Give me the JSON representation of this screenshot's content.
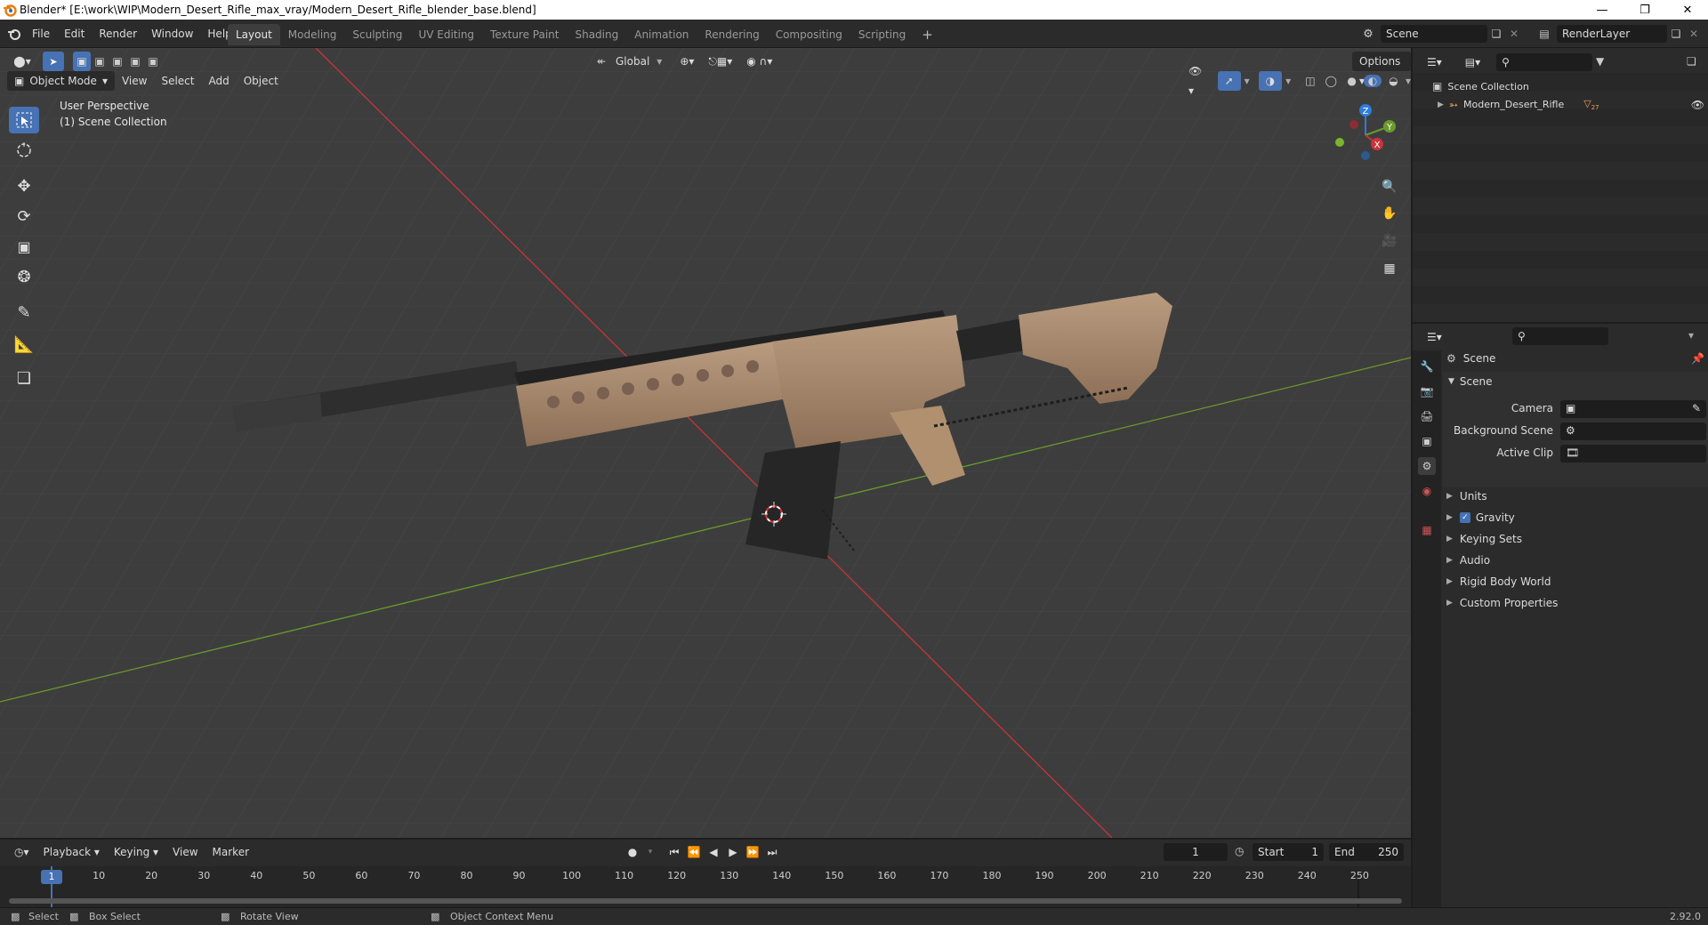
{
  "app": {
    "title": "Blender* [E:\\work\\WIP\\Modern_Desert_Rifle_max_vray/Modern_Desert_Rifle_blender_base.blend]",
    "version": "2.92.0"
  },
  "menu": [
    "File",
    "Edit",
    "Render",
    "Window",
    "Help"
  ],
  "workspaces": [
    "Layout",
    "Modeling",
    "Sculpting",
    "UV Editing",
    "Texture Paint",
    "Shading",
    "Animation",
    "Rendering",
    "Compositing",
    "Scripting"
  ],
  "active_workspace": "Layout",
  "scene_field": "Scene",
  "render_layer": "RenderLayer",
  "viewport": {
    "orientation": "Global",
    "options_label": "Options",
    "mode": "Object Mode",
    "menus": [
      "View",
      "Select",
      "Add",
      "Object"
    ],
    "overlay_line1": "User Perspective",
    "overlay_line2": "(1) Scene Collection",
    "gizmo": {
      "z": "Z",
      "y": "Y",
      "x": "X"
    }
  },
  "outliner": {
    "root": "Scene Collection",
    "item": "Modern_Desert_Rifle",
    "item_badge": "27"
  },
  "properties": {
    "context_title": "Scene",
    "panel_title": "Scene",
    "fields": [
      {
        "label": "Camera"
      },
      {
        "label": "Background Scene"
      },
      {
        "label": "Active Clip"
      }
    ],
    "panels": [
      "Units",
      "Gravity",
      "Keying Sets",
      "Audio",
      "Rigid Body World",
      "Custom Properties"
    ],
    "gravity_checked": true
  },
  "timeline": {
    "menus": [
      "Playback",
      "Keying",
      "View",
      "Marker"
    ],
    "current_frame": "1",
    "start_label": "Start",
    "start": "1",
    "end_label": "End",
    "end": "250",
    "ticks": [
      "1",
      "10",
      "20",
      "30",
      "40",
      "50",
      "60",
      "70",
      "80",
      "90",
      "100",
      "110",
      "120",
      "130",
      "140",
      "150",
      "160",
      "170",
      "180",
      "190",
      "200",
      "210",
      "220",
      "230",
      "240",
      "250"
    ]
  },
  "status": {
    "select": "Select",
    "box_select": "Box Select",
    "rotate_view": "Rotate View",
    "context_menu": "Object Context Menu"
  },
  "colors": {
    "accent": "#4772b3",
    "x_axis": "#c8343b",
    "y_axis": "#6a9a2c",
    "z_axis": "#2f7dd8",
    "rifle_tan": "#a98a6e",
    "rifle_dark": "#2a2a2a"
  }
}
